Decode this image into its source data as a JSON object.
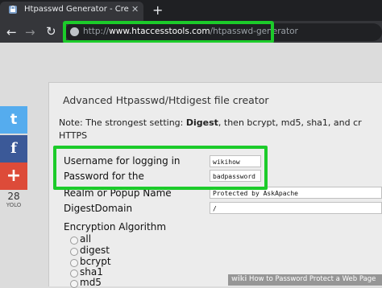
{
  "browser": {
    "tab_title": "Htpasswd Generator - Create Ht",
    "tab_close": "✕",
    "new_tab": "+",
    "url_prefix": "http://",
    "url_domain": "www.htaccesstools.com",
    "url_path": "/htpasswd-generator"
  },
  "page": {
    "heading": "Advanced Htpasswd/Htdigest file creator",
    "note_prefix": "Note: The strongest setting: ",
    "note_bold": "Digest",
    "note_suffix": ", then bcrypt, md5, sha1, and cr",
    "note_line2": "HTTPS",
    "fields": [
      {
        "label": "Username for logging in",
        "value": "wikihow"
      },
      {
        "label": "Password for the",
        "value": "badpassword"
      },
      {
        "label": "Realm or Popup Name",
        "value": "Protected by AskApache"
      },
      {
        "label": "DigestDomain",
        "value": "/"
      }
    ],
    "encryption_label": "Encryption Algorithm",
    "algorithms": [
      "all",
      "digest",
      "bcrypt",
      "sha1",
      "md5"
    ]
  },
  "social": {
    "twitter": "t",
    "facebook": "f",
    "googleplus": "+",
    "count": "28",
    "count_label": "YOLO"
  },
  "watermark": {
    "brand": "wiki",
    "caption": "How to Password Protect a Web Page"
  },
  "colors": {
    "highlight": "#1ccb2a",
    "twitter": "#55acee",
    "facebook": "#3b5998",
    "googleplus": "#dd4b39"
  }
}
